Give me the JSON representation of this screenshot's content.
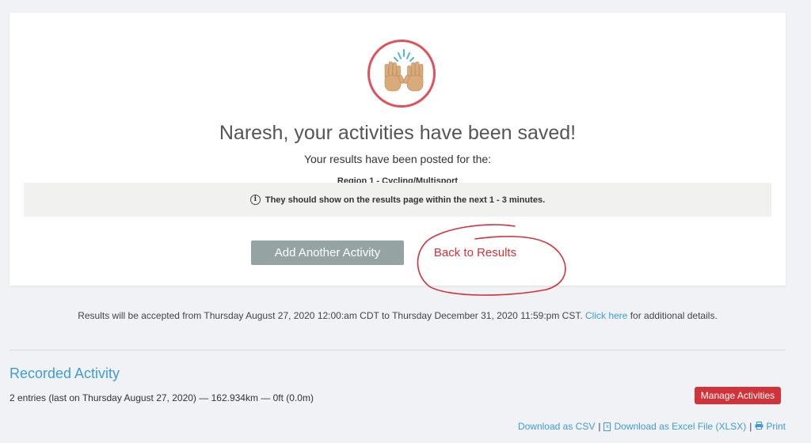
{
  "card": {
    "icon": "raising-hands-icon",
    "headline": "Naresh, your activities have been saved!",
    "subline": "Your results have been posted for the:",
    "region": "Region 1 - Cycling/Multisport",
    "notice": "They should show on the results page within the next 1 - 3 minutes.",
    "add_button": "Add Another Activity",
    "back_button": "Back to Results"
  },
  "accept": {
    "text": "Results will be accepted from Thursday August 27, 2020 12:00:am CDT to Thursday December 31, 2020 11:59:pm CST.",
    "link": "Click here",
    "suffix": "for additional details."
  },
  "recorded": {
    "title": "Recorded Activity",
    "entries": "2 entries (last on Thursday August 27, 2020) — 162.934km — 0ft (0.0m)",
    "manage_button": "Manage Activities",
    "download_csv": "Download as CSV",
    "download_xlsx": "Download as Excel File (XLSX)",
    "print": "Print",
    "separator": "|"
  },
  "colors": {
    "accent_red": "#d2323a",
    "link_blue": "#3d9cd8",
    "button_gray": "#95a4a2",
    "background": "#f1f2f5"
  }
}
